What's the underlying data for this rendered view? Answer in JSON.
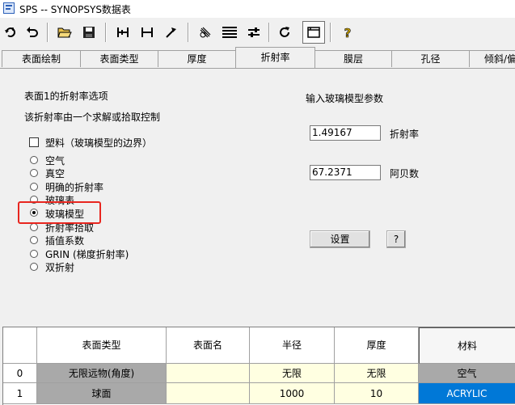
{
  "window": {
    "title": "SPS -- SYNOPSYS数据表"
  },
  "toolbar": {
    "buttons": [
      "undo-redo-icon",
      "undo-icon",
      "open-folder-icon",
      "save-disk-icon",
      "insert-surface-icon",
      "delete-surface-icon",
      "pick-icon",
      "glass-icon",
      "table-icon",
      "adjust-icon",
      "refresh-icon",
      "window-icon",
      "help-question-icon"
    ]
  },
  "tabs": [
    {
      "label": "表面绘制"
    },
    {
      "label": "表面类型"
    },
    {
      "label": "厚度"
    },
    {
      "label": "折射率",
      "active": true
    },
    {
      "label": "膜层"
    },
    {
      "label": "孔径"
    },
    {
      "label": "倾斜/偏"
    }
  ],
  "panel": {
    "heading": "表面1的折射率选项",
    "subheading": "该折射率由一个求解或拾取控制",
    "checkbox_label": "塑料（玻璃模型的边界）",
    "options": [
      {
        "label": "空气"
      },
      {
        "label": "真空"
      },
      {
        "label": "明确的折射率"
      },
      {
        "label": "玻璃表"
      },
      {
        "label": "玻璃模型",
        "selected": true
      },
      {
        "label": "折射率拾取"
      },
      {
        "label": "插值系数"
      },
      {
        "label": "GRIN (梯度折射率)"
      },
      {
        "label": "双折射"
      }
    ],
    "right_heading": "输入玻璃模型参数",
    "index_value": "1.49167",
    "index_label": "折射率",
    "abbe_value": "67.2371",
    "abbe_label": "阿贝数",
    "set_button": "设置",
    "help_button": "?"
  },
  "table": {
    "headers": [
      "表面类型",
      "表面名",
      "半径",
      "厚度",
      "材料"
    ],
    "rows": [
      {
        "num": "0",
        "type": "无限远物(角度)",
        "name": "",
        "radius": "无限",
        "thickness": "无限",
        "material": "空气"
      },
      {
        "num": "1",
        "type": "球面",
        "name": "",
        "radius": "1000",
        "thickness": "10",
        "material": "ACRYLIC"
      }
    ]
  },
  "colors": {
    "highlight": "#e8261f",
    "selection": "#0078d7",
    "cell_yellow": "#ffffe1",
    "header_gray": "#a9a9a9"
  }
}
